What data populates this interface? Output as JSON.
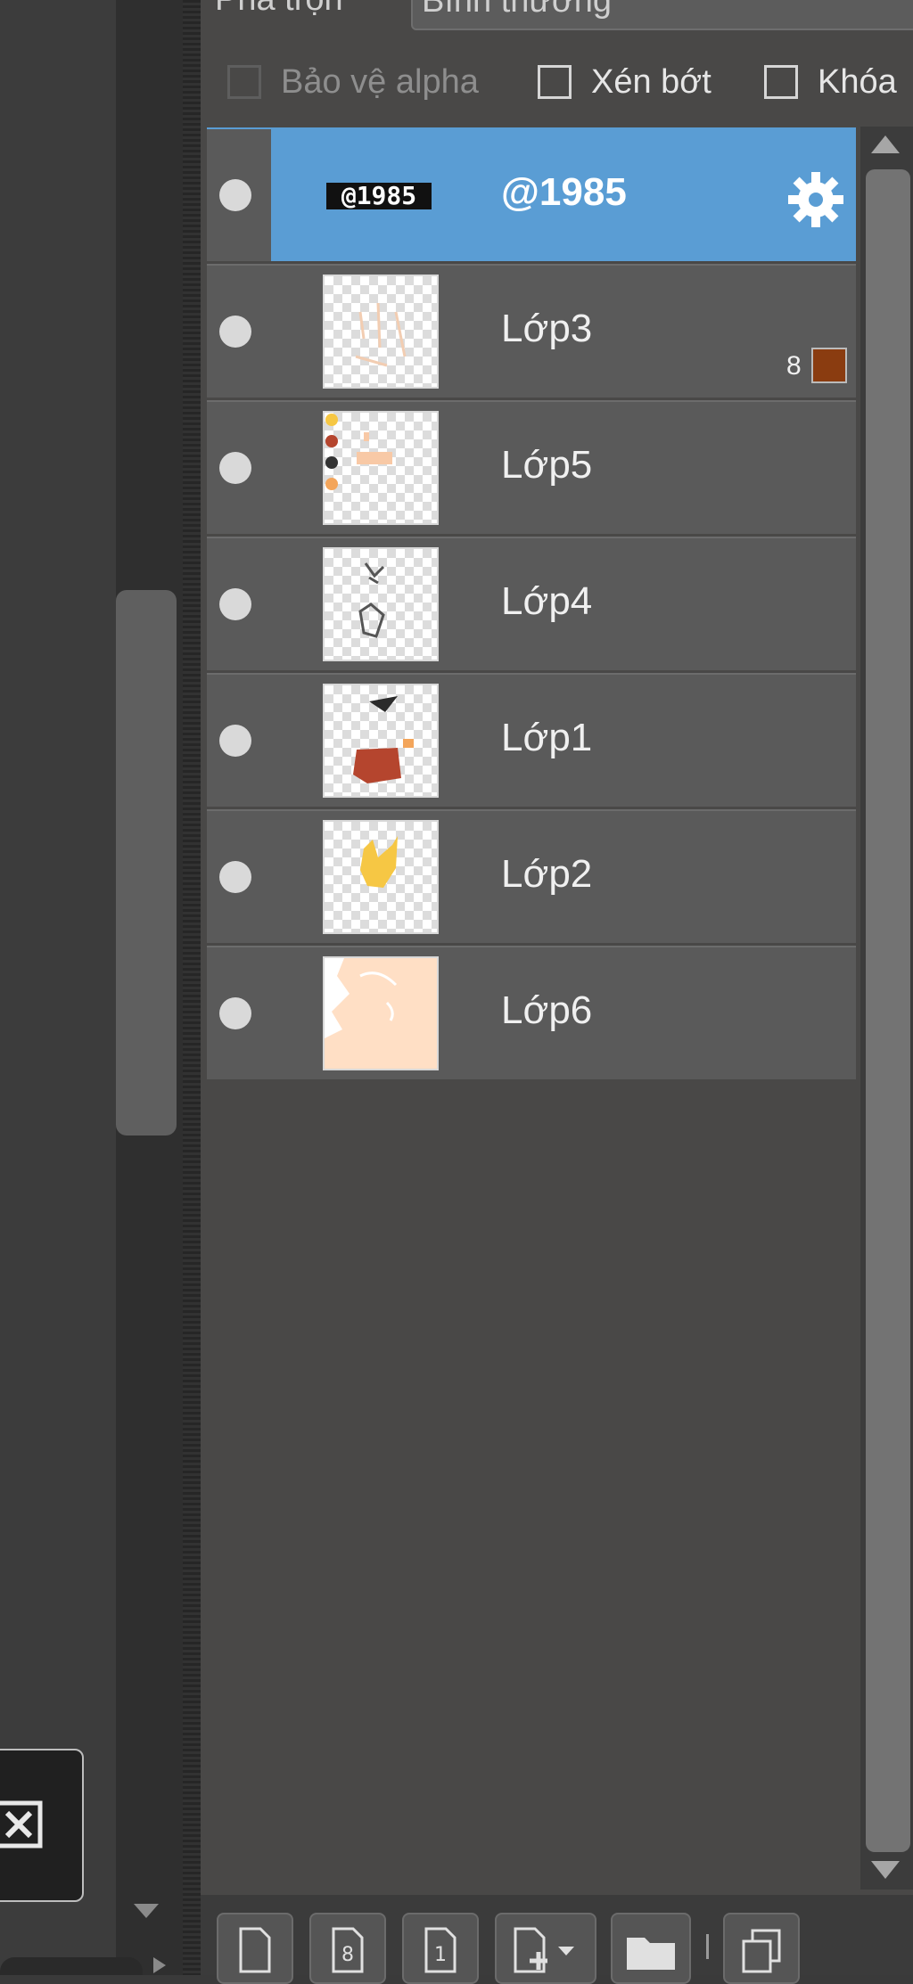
{
  "blend": {
    "label": "Pha trộn",
    "value": "Bình thường"
  },
  "options": {
    "protect_alpha": "Bảo vệ alpha",
    "clipping": "Xén bớt",
    "lock": "Khóa"
  },
  "layers": [
    {
      "name": "@1985",
      "selected": true,
      "thumb_text": "@1985"
    },
    {
      "name": "Lớp3",
      "mask_count": "8",
      "mask_color": "#8a3c10"
    },
    {
      "name": "Lớp5"
    },
    {
      "name": "Lớp4"
    },
    {
      "name": "Lớp1"
    },
    {
      "name": "Lớp2"
    },
    {
      "name": "Lớp6"
    }
  ],
  "colors": {
    "selected_row": "#5a9dd4",
    "row": "#5a5a5a",
    "panel": "#494847",
    "skin": "#ffdfc5",
    "dress_red": "#b5452e",
    "yellow": "#f6c744"
  },
  "icons": {
    "visibility": "eye-toggle",
    "settings": "gear-icon",
    "close": "close-box-icon",
    "new_layer": "new-layer-icon",
    "layer_8bit": "layer-8bit-icon",
    "layer_1bit": "layer-1bit-icon",
    "add_layer_menu": "add-layer-menu-icon",
    "folder": "folder-icon",
    "duplicate": "duplicate-icon"
  }
}
